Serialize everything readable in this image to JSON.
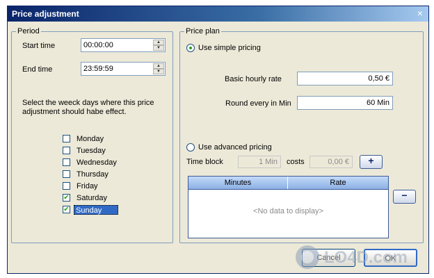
{
  "window": {
    "title": "Price adjustment",
    "close_glyph": "×"
  },
  "period": {
    "legend": "Period",
    "start_label": "Start time",
    "start_value": "00:00:00",
    "end_label": "End time",
    "end_value": "23:59:59",
    "note": "Select the weeck days where this price adjustment should habe effect.",
    "days": [
      {
        "label": "Monday",
        "checked": false,
        "selected": false
      },
      {
        "label": "Tuesday",
        "checked": false,
        "selected": false
      },
      {
        "label": "Wednesday",
        "checked": false,
        "selected": false
      },
      {
        "label": "Thursday",
        "checked": false,
        "selected": false
      },
      {
        "label": "Friday",
        "checked": false,
        "selected": false
      },
      {
        "label": "Saturday",
        "checked": true,
        "selected": false
      },
      {
        "label": "Sunday",
        "checked": true,
        "selected": true
      }
    ]
  },
  "price_plan": {
    "legend": "Price plan",
    "simple_label": "Use simple pricing",
    "simple_selected": true,
    "basic_rate_label": "Basic hourly rate",
    "basic_rate_value": "0,50 €",
    "round_label": "Round every in Min",
    "round_value": "60 Min",
    "advanced_label": "Use advanced pricing",
    "time_block_label": "Time block",
    "time_block_value": "1 Min",
    "costs_label": "costs",
    "costs_value": "0,00 €",
    "add_glyph": "+",
    "remove_glyph": "−",
    "table": {
      "columns": [
        "Minutes",
        "Rate"
      ],
      "empty_text": "<No data to display>"
    }
  },
  "buttons": {
    "cancel": "Cancel",
    "ok": "OK"
  },
  "watermark": "LO4D.com",
  "colors": {
    "title_bar": "#0a246a",
    "selection": "#316ac5",
    "check": "#21a121"
  }
}
